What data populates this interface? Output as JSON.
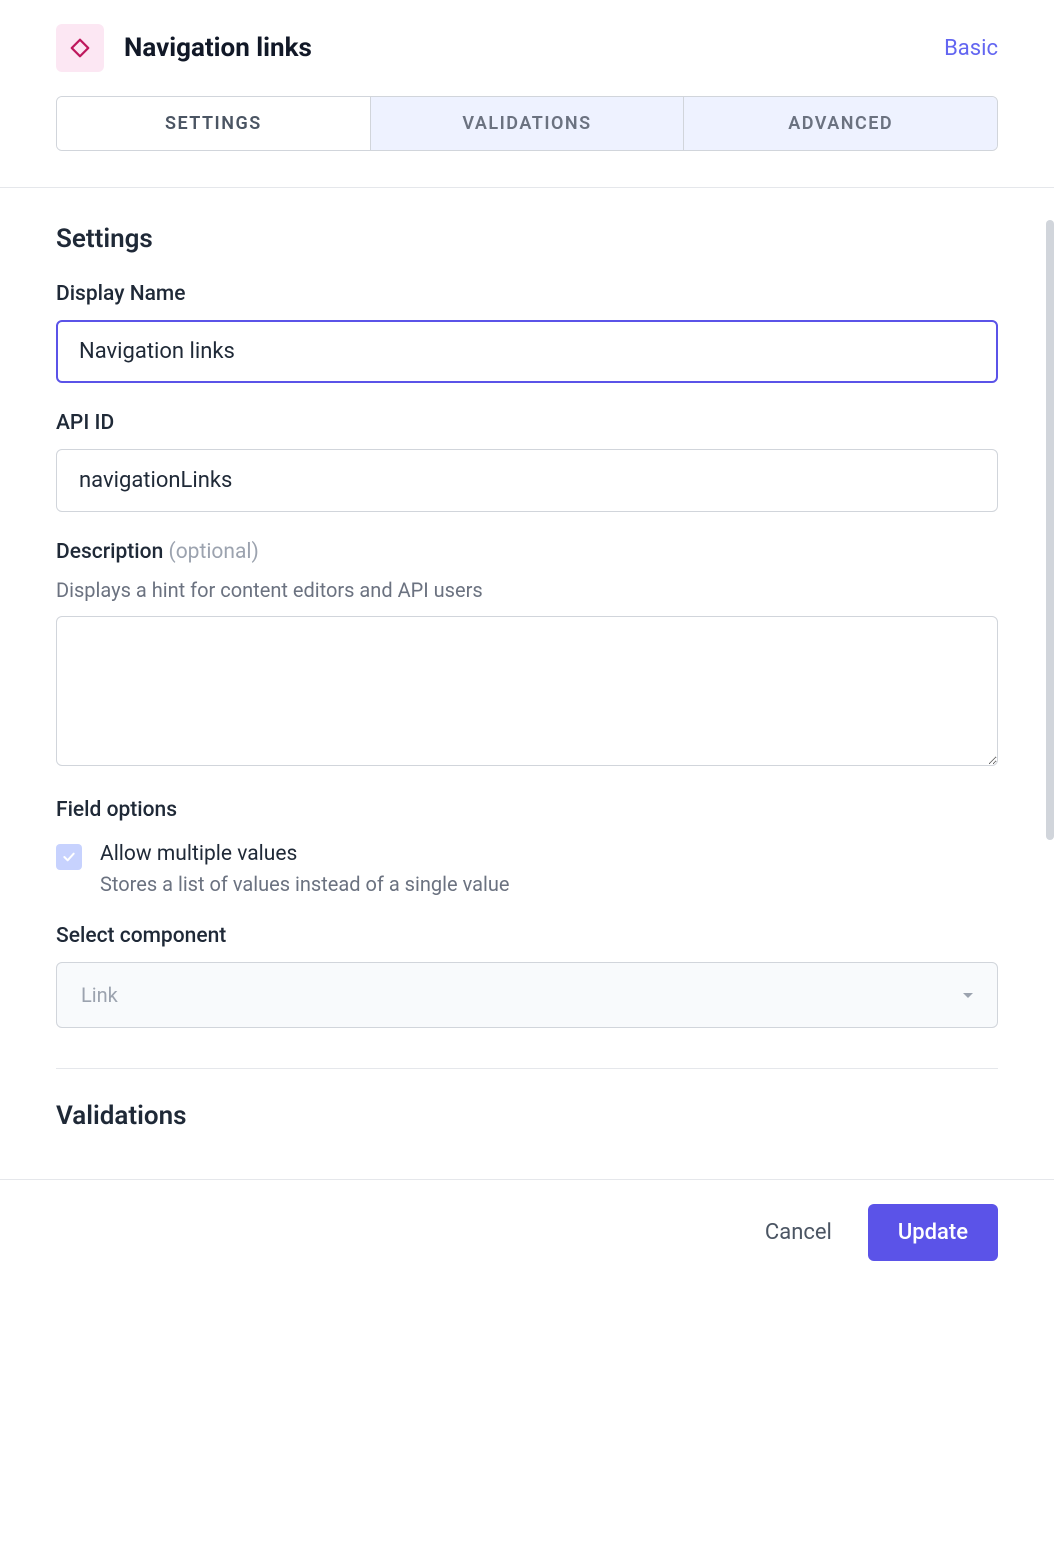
{
  "header": {
    "title": "Navigation links",
    "type_label": "Basic"
  },
  "tabs": [
    {
      "label": "SETTINGS",
      "active": true
    },
    {
      "label": "VALIDATIONS",
      "active": false
    },
    {
      "label": "ADVANCED",
      "active": false
    }
  ],
  "sections": {
    "settings": {
      "title": "Settings",
      "display_name": {
        "label": "Display Name",
        "value": "Navigation links"
      },
      "api_id": {
        "label": "API ID",
        "value": "navigationLinks"
      },
      "description": {
        "label": "Description",
        "optional": "(optional)",
        "hint": "Displays a hint for content editors and API users",
        "value": ""
      },
      "field_options": {
        "title": "Field options",
        "allow_multiple": {
          "label": "Allow multiple values",
          "hint": "Stores a list of values instead of a single value",
          "checked": true
        }
      },
      "select_component": {
        "label": "Select component",
        "selected": "Link"
      }
    },
    "validations": {
      "title": "Validations"
    }
  },
  "footer": {
    "cancel": "Cancel",
    "update": "Update"
  },
  "colors": {
    "accent": "#5b53e8",
    "icon_bg": "#fce7f3",
    "icon_stroke": "#be185d"
  }
}
